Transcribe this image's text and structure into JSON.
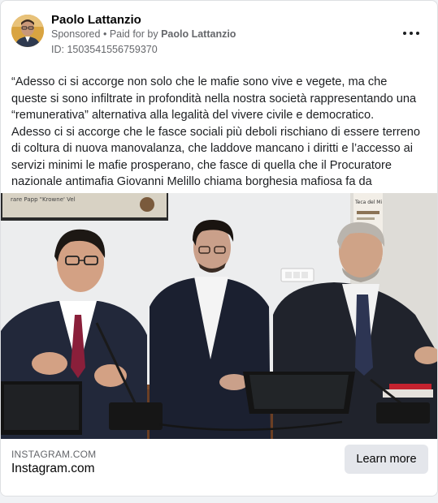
{
  "post": {
    "author": "Paolo Lattanzio",
    "sponsored_label": "Sponsored",
    "separator": "•",
    "paid_for_prefix": "Paid for by",
    "paid_for_name": "Paolo Lattanzio",
    "ad_id": "ID: 1503541556759370",
    "menu_icon": "more-horizontal-icon",
    "paragraphs": [
      "“Adesso ci si accorge non solo che le mafie sono vive e vegete, ma che queste si sono infiltrate in profondità nella nostra società rappresentando una “remunerativa” alternativa alla legalità del vivere civile e democratico.",
      "Adesso ci si accorge che le fasce sociali più deboli rischiano di essere terreno di coltura di nuova manovalanza, che laddove mancano i diritti e l’accesso ai servizi minimi le mafie prosperano, che fasce di quella che il Procuratore nazionale antimafia Giovanni Melillo chiama borghesia mafiosa fa da acceleratore degli…"
    ]
  },
  "photo": {
    "screen_text": "rare Papp \"Krowne' Vel",
    "poster_text": "Teca del Mi"
  },
  "link": {
    "domain_caps": "INSTAGRAM.COM",
    "title": "Instagram.com",
    "cta": "Learn more"
  }
}
